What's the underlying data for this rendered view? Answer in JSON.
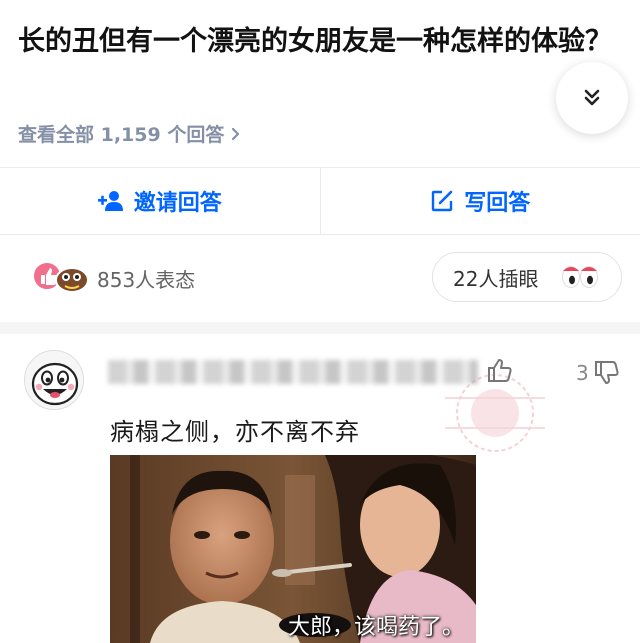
{
  "question": {
    "title": "长的丑但有一个漂亮的女朋友是一种怎样的体验？",
    "view_all": "查看全部 1,159 个回答"
  },
  "actions": {
    "invite_label": "邀请回答",
    "write_label": "写回答"
  },
  "reactions": {
    "count_label": "853人表态",
    "eye_label": "22人插眼"
  },
  "answer": {
    "vote_count": "3",
    "text": "病榻之侧，亦不离不弃",
    "image_caption": "大郎，该喝药了。"
  },
  "colors": {
    "accent": "#0066ff",
    "muted": "#8590a6"
  },
  "icons": [
    "chevron-double-down-icon",
    "chevron-right-icon",
    "add-user-icon",
    "edit-icon",
    "thumb-up-icon",
    "thumb-down-icon",
    "eyes-icon"
  ]
}
